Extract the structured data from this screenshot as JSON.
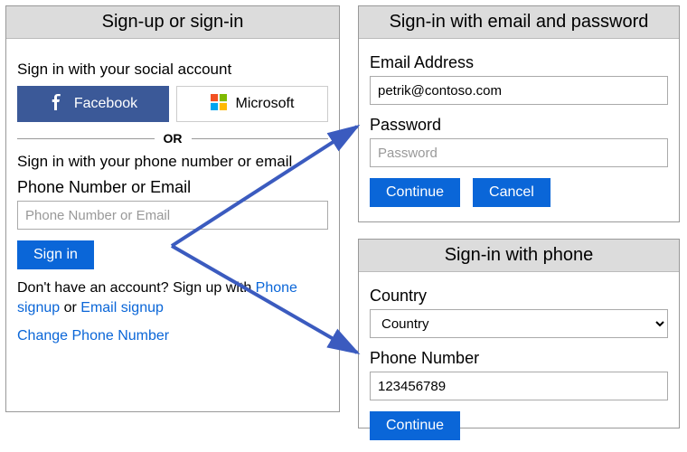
{
  "left": {
    "title": "Sign-up or sign-in",
    "social_heading": "Sign in with your social account",
    "facebook": "Facebook",
    "microsoft": "Microsoft",
    "or": "OR",
    "phone_heading": "Sign in with your phone number or email",
    "phone_label": "Phone Number or Email",
    "phone_placeholder": "Phone Number or Email",
    "signin_btn": "Sign in",
    "dont_have_prefix": "Don't have an account? Sign up with ",
    "phone_signup_link": "Phone signup",
    "or_word": " or ",
    "email_signup_link": "Email signup",
    "change_phone": "Change Phone Number"
  },
  "email_panel": {
    "title": "Sign-in with email and password",
    "email_label": "Email Address",
    "email_value": "petrik@contoso.com",
    "password_label": "Password",
    "password_placeholder": "Password",
    "continue": "Continue",
    "cancel": "Cancel"
  },
  "phone_panel": {
    "title": "Sign-in with phone",
    "country_label": "Country",
    "country_selected": "Country",
    "phone_label": "Phone Number",
    "phone_value": "123456789",
    "continue": "Continue"
  }
}
